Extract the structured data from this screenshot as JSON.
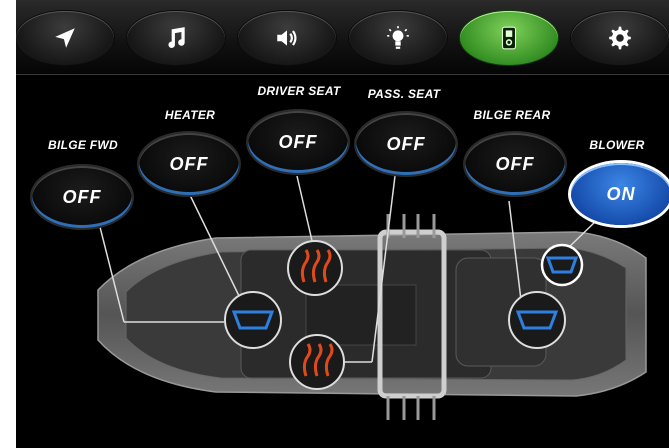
{
  "nav": {
    "items": [
      {
        "icon": "navigation-arrow-icon",
        "active": false
      },
      {
        "icon": "music-note-icon",
        "active": false
      },
      {
        "icon": "speaker-icon",
        "active": false
      },
      {
        "icon": "lightbulb-icon",
        "active": false
      },
      {
        "icon": "switch-panel-icon",
        "active": true
      },
      {
        "icon": "gear-icon",
        "active": false
      }
    ]
  },
  "zones": {
    "bilge_fwd": {
      "label": "BILGE FWD",
      "state": "OFF"
    },
    "heater": {
      "label": "HEATER",
      "state": "OFF"
    },
    "driver_seat": {
      "label": "DRIVER SEAT",
      "state": "OFF"
    },
    "pass_seat": {
      "label": "PASS. SEAT",
      "state": "OFF"
    },
    "bilge_rear": {
      "label": "BILGE REAR",
      "state": "OFF"
    },
    "blower": {
      "label": "BLOWER",
      "state": "ON"
    }
  },
  "colors": {
    "accent_green": "#3f9a2a",
    "accent_blue": "#1f63c7",
    "background": "#000000"
  }
}
